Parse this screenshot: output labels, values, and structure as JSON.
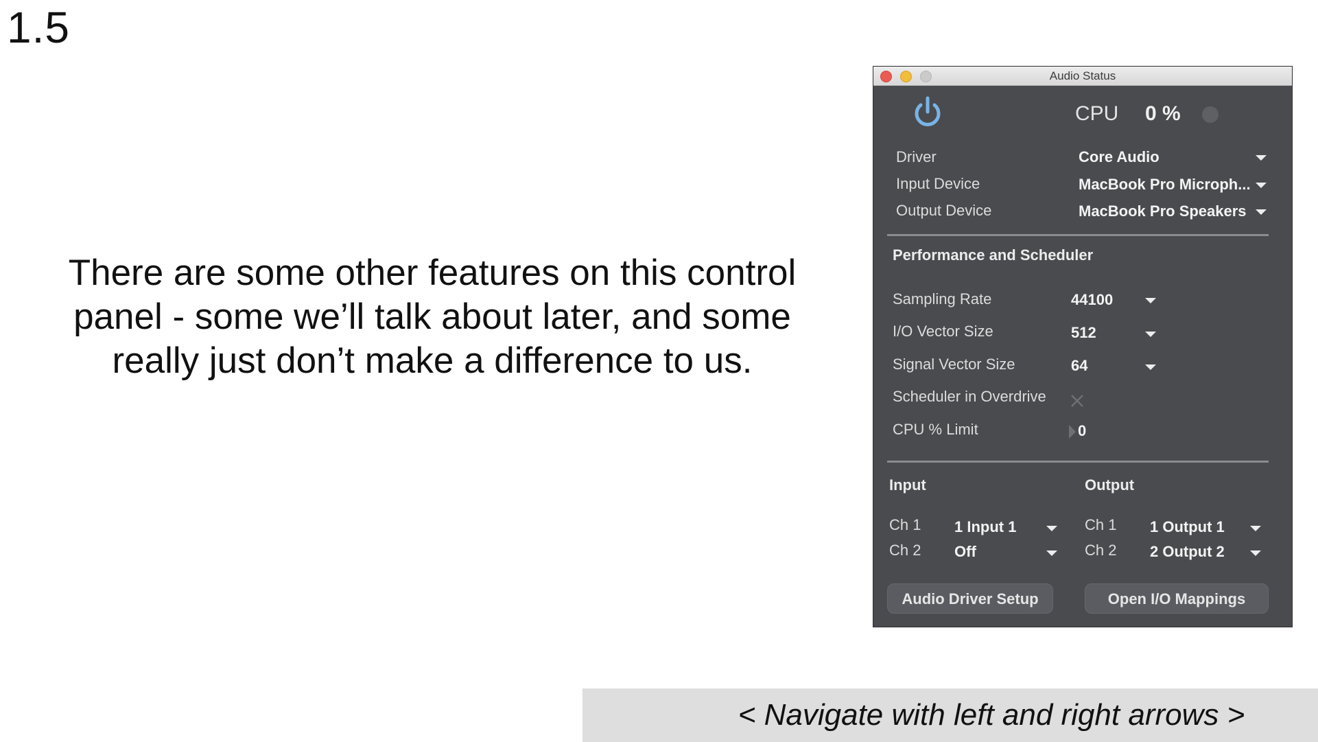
{
  "slide": {
    "number": "1.5",
    "body_text": "There are some other features on this control panel - some we’ll talk about later, and some really just don’t make a difference to us.",
    "nav_text": "< Navigate with left and right arrows >"
  },
  "window": {
    "title": "Audio Status",
    "cpu_label": "CPU",
    "cpu_value": "0 %",
    "icons": [
      "power-icon",
      "close-icon",
      "minimize-icon",
      "zoom-icon",
      "chevron-down-icon",
      "x-icon",
      "play-triangle-icon"
    ],
    "colors": {
      "background": "#4a4b4f",
      "power_icon": "#7ab3e6",
      "close": "#ec5b53",
      "minimize": "#f2bd3a",
      "zoom": "#cbcbcb"
    },
    "device_rows": [
      {
        "label": "Driver",
        "value": "Core Audio"
      },
      {
        "label": "Input Device",
        "value": "MacBook Pro Microph..."
      },
      {
        "label": "Output Device",
        "value": "MacBook Pro Speakers"
      }
    ],
    "performance": {
      "heading": "Performance and Scheduler",
      "rows": [
        {
          "label": "Sampling Rate",
          "value": "44100"
        },
        {
          "label": "I/O Vector Size",
          "value": "512"
        },
        {
          "label": "Signal Vector Size",
          "value": "64"
        },
        {
          "label": "Scheduler in Overdrive",
          "value": ""
        },
        {
          "label": "CPU % Limit",
          "value": "0"
        }
      ]
    },
    "io": {
      "input_heading": "Input",
      "output_heading": "Output",
      "inputs": [
        {
          "label": "Ch 1",
          "value": "1 Input 1"
        },
        {
          "label": "Ch 2",
          "value": "Off"
        }
      ],
      "outputs": [
        {
          "label": "Ch 1",
          "value": "1 Output 1"
        },
        {
          "label": "Ch 2",
          "value": "2 Output 2"
        }
      ]
    },
    "buttons": {
      "driver_setup": "Audio Driver Setup",
      "io_mappings": "Open I/O Mappings"
    }
  }
}
